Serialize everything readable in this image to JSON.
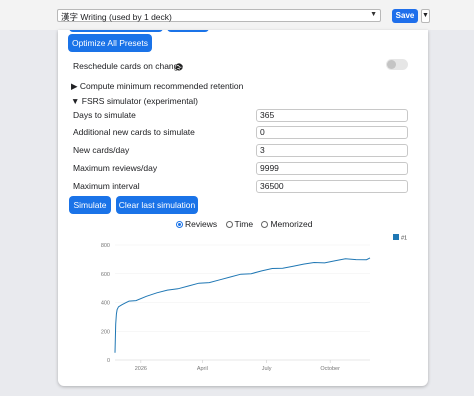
{
  "top_bar": {
    "deck_select_value": "漢字 Writing (used by 1 deck)",
    "save_label": "Save"
  },
  "presets": {
    "optimize_all_label": "Optimize All Presets"
  },
  "reschedule": {
    "label": "Reschedule cards on change",
    "enabled": false
  },
  "sections": {
    "compute_retention_label": "Compute minimum recommended retention",
    "fsrs_simulator_label": "FSRS simulator (experimental)"
  },
  "simulator": {
    "fields": [
      {
        "label": "Days to simulate",
        "value": "365"
      },
      {
        "label": "Additional new cards to simulate",
        "value": "0"
      },
      {
        "label": "New cards/day",
        "value": "3"
      },
      {
        "label": "Maximum reviews/day",
        "value": "9999"
      },
      {
        "label": "Maximum interval",
        "value": "36500"
      }
    ],
    "simulate_label": "Simulate",
    "clear_label": "Clear last simulation",
    "radio_options": [
      {
        "label": "Reviews",
        "selected": true
      },
      {
        "label": "Time",
        "selected": false
      },
      {
        "label": "Memorized",
        "selected": false
      }
    ]
  },
  "chart_data": {
    "type": "line",
    "x_tick_labels": [
      "2026",
      "April",
      "July",
      "October"
    ],
    "y_tick_labels": [
      "0",
      "200",
      "400",
      "600",
      "800"
    ],
    "ylim": [
      0,
      800
    ],
    "legend": [
      "#1"
    ],
    "series_color": "#1f77b4",
    "series": [
      {
        "name": "#1",
        "x": [
          0,
          1,
          2,
          3,
          5,
          10,
          20,
          30,
          45,
          60,
          75,
          90,
          105,
          120,
          135,
          150,
          165,
          180,
          195,
          210,
          225,
          240,
          255,
          270,
          285,
          300,
          315,
          330,
          345,
          360,
          365
        ],
        "y": [
          50,
          250,
          320,
          350,
          370,
          385,
          405,
          420,
          445,
          465,
          480,
          500,
          515,
          530,
          545,
          560,
          575,
          590,
          605,
          620,
          632,
          645,
          655,
          665,
          672,
          680,
          690,
          700,
          705,
          700,
          710
        ]
      }
    ]
  }
}
